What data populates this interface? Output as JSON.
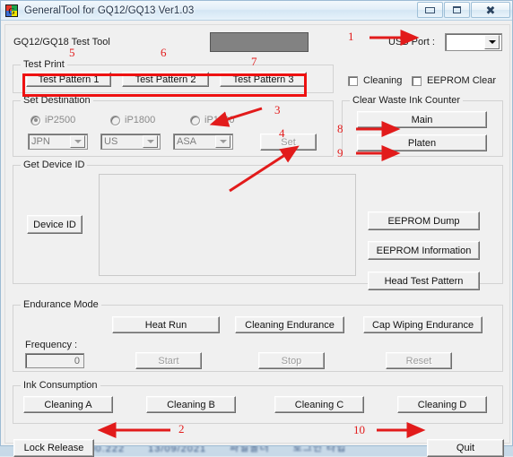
{
  "window": {
    "title": "GeneralTool for GQ12/GQ13 Ver1.03",
    "app_icon": "app-logo-icon",
    "minimize_label": "Minimize",
    "maximize_label": "Maximize",
    "close_label": "Close"
  },
  "header": {
    "tool_label": "GQ12/GQ18 Test Tool",
    "usb_port_label": "USB Port :",
    "usb_port_value": "",
    "status_box_value": ""
  },
  "test_print": {
    "title": "Test Print",
    "buttons": [
      {
        "label": "Test Pattern 1"
      },
      {
        "label": "Test Pattern 2"
      },
      {
        "label": "Test Pattern 3"
      }
    ]
  },
  "options": {
    "cleaning_label": "Cleaning",
    "cleaning_checked": false,
    "eeprom_clear_label": "EEPROM Clear",
    "eeprom_clear_checked": false
  },
  "set_destination": {
    "title": "Set Destination",
    "radios": [
      {
        "label": "iP2500",
        "selected": true
      },
      {
        "label": "iP1800",
        "selected": false
      },
      {
        "label": "iP1100",
        "selected": false
      }
    ],
    "combos": [
      {
        "value": "JPN"
      },
      {
        "value": "US"
      },
      {
        "value": "ASA"
      }
    ],
    "set_label": "Set"
  },
  "clear_waste_ink": {
    "title": "Clear Waste Ink Counter",
    "main_label": "Main",
    "platen_label": "Platen"
  },
  "get_device_id": {
    "title": "Get Device ID",
    "device_id_label": "Device ID",
    "output_text": "",
    "buttons": [
      {
        "label": "EEPROM Dump"
      },
      {
        "label": "EEPROM Information"
      },
      {
        "label": "Head Test Pattern"
      }
    ]
  },
  "endurance_mode": {
    "title": "Endurance Mode",
    "heat_run_label": "Heat Run",
    "cleaning_endurance_label": "Cleaning Endurance",
    "cap_wiping_endurance_label": "Cap Wiping Endurance",
    "frequency_label": "Frequency :",
    "frequency_value": "0",
    "start_label": "Start",
    "stop_label": "Stop",
    "reset_label": "Reset"
  },
  "ink_consumption": {
    "title": "Ink Consumption",
    "buttons": [
      {
        "label": "Cleaning A"
      },
      {
        "label": "Cleaning B"
      },
      {
        "label": "Cleaning C"
      },
      {
        "label": "Cleaning D"
      }
    ]
  },
  "footer": {
    "lock_release_label": "Lock Release",
    "quit_label": "Quit"
  },
  "annotations": {
    "color": "#e21b1b",
    "numbers": [
      {
        "id": "1",
        "text": "1"
      },
      {
        "id": "2",
        "text": "2"
      },
      {
        "id": "3",
        "text": "3"
      },
      {
        "id": "4",
        "text": "4"
      },
      {
        "id": "5",
        "text": "5"
      },
      {
        "id": "6",
        "text": "6"
      },
      {
        "id": "7",
        "text": "7"
      },
      {
        "id": "8",
        "text": "8"
      },
      {
        "id": "9",
        "text": "9"
      },
      {
        "id": "10",
        "text": "10"
      }
    ]
  }
}
